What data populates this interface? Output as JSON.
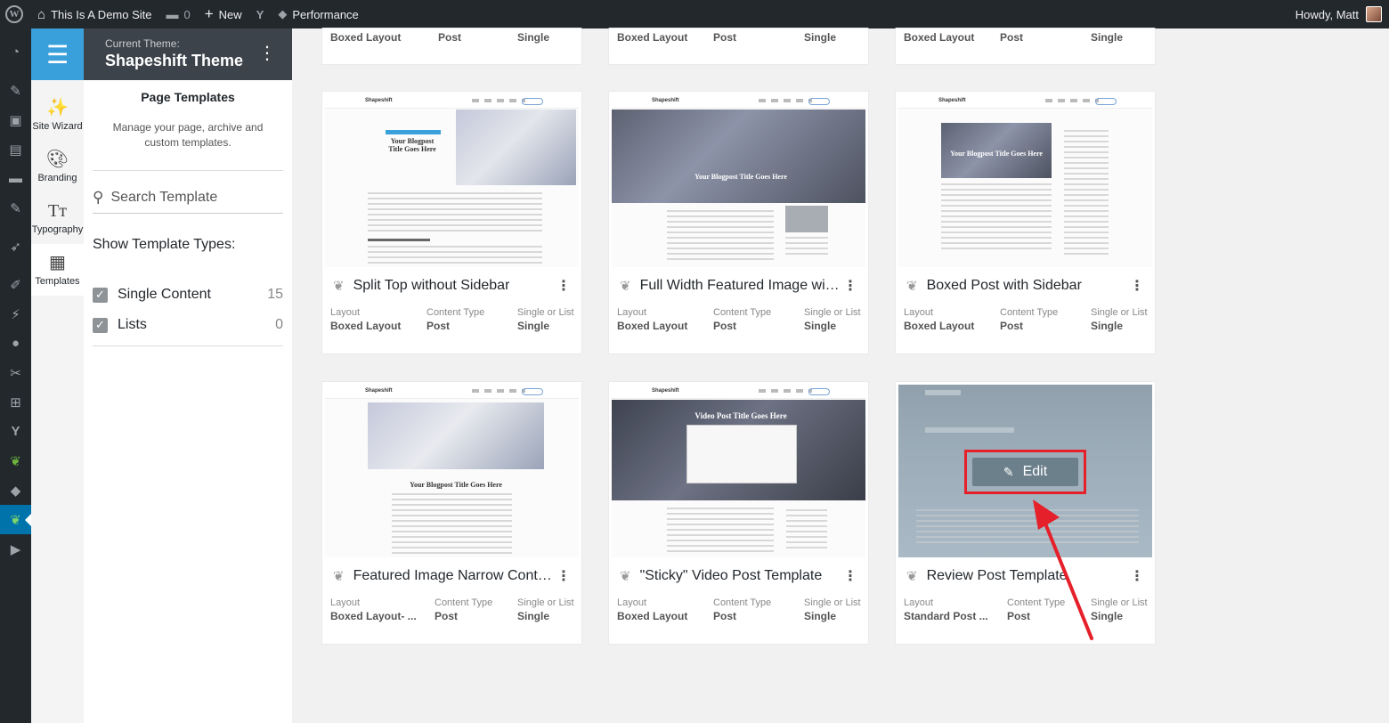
{
  "adminbar": {
    "site_name": "This Is A Demo Site",
    "comments_count": "0",
    "new_label": "New",
    "performance_label": "Performance",
    "howdy": "Howdy, Matt"
  },
  "theme": {
    "current_label": "Current Theme:",
    "name": "Shapeshift Theme"
  },
  "rail": {
    "tools": [
      {
        "label": "Site Wizard",
        "icon": "magic-wand-icon"
      },
      {
        "label": "Branding",
        "icon": "palette-icon"
      },
      {
        "label": "Typography",
        "icon": "typography-icon"
      },
      {
        "label": "Templates",
        "icon": "templates-icon"
      }
    ]
  },
  "panel": {
    "title": "Page Templates",
    "description": "Manage your page, archive and custom templates.",
    "search_placeholder": "Search Template",
    "types_label": "Show Template Types:",
    "types": [
      {
        "label": "Single Content",
        "count": "15",
        "checked": true
      },
      {
        "label": "Lists",
        "count": "0",
        "checked": true
      }
    ]
  },
  "meta_labels": {
    "layout": "Layout",
    "content_type": "Content Type",
    "single_or_list": "Single or List"
  },
  "cards_top": [
    {
      "layout": "Boxed Layout",
      "content_type": "Post",
      "single_list": "Single"
    },
    {
      "layout": "Boxed Layout",
      "content_type": "Post",
      "single_list": "Single"
    },
    {
      "layout": "Boxed Layout",
      "content_type": "Post",
      "single_list": "Single"
    }
  ],
  "cards": [
    {
      "title": "Split Top without Sidebar",
      "layout": "Boxed Layout",
      "content_type": "Post",
      "single_list": "Single",
      "thumb_title": "Your Blogpost Title Goes Here"
    },
    {
      "title": "Full Width Featured Image with Sidebar",
      "layout": "Boxed Layout",
      "content_type": "Post",
      "single_list": "Single",
      "thumb_title": "Your Blogpost Title Goes Here"
    },
    {
      "title": "Boxed Post with Sidebar",
      "layout": "Boxed Layout",
      "content_type": "Post",
      "single_list": "Single",
      "thumb_title": "Your Blogpost Title Goes Here"
    },
    {
      "title": "Featured Image Narrow Content",
      "layout": "Boxed Layout- ...",
      "content_type": "Post",
      "single_list": "Single",
      "thumb_title": "Your Blogpost Title Goes Here"
    },
    {
      "title": "\"Sticky\" Video Post Template",
      "layout": "Boxed Layout",
      "content_type": "Post",
      "single_list": "Single",
      "thumb_title": "Video Post Title Goes Here"
    },
    {
      "title": "Review Post Template",
      "layout": "Standard Post ...",
      "content_type": "Post",
      "single_list": "Single",
      "edit_label": "Edit"
    }
  ],
  "thumb_brand": "Shapeshift",
  "colors": {
    "adminbar_bg": "#23282d",
    "accent_blue": "#3aa0db",
    "highlight_red": "#e5202a"
  }
}
